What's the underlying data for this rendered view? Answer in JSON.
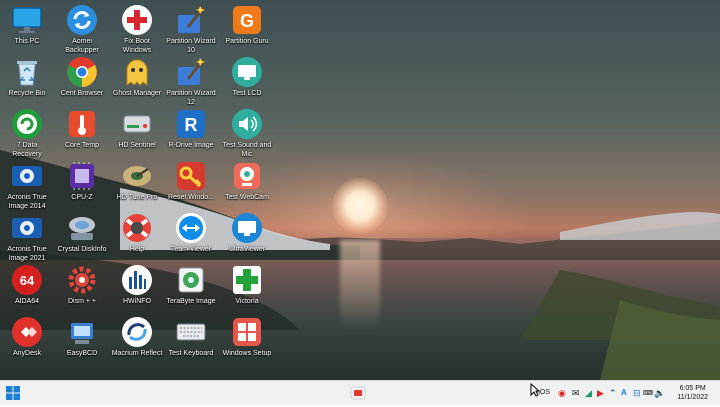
{
  "desktop_icons": [
    {
      "label": "This PC",
      "icon": "monitor-icon"
    },
    {
      "label": "Aomei Backupper",
      "icon": "refresh-arrows-icon"
    },
    {
      "label": "Fix Boot Windows",
      "icon": "red-cross-icon"
    },
    {
      "label": "Partition Wizard 10",
      "icon": "magic-wand-icon"
    },
    {
      "label": "Partition Guru",
      "icon": "partition-guru-icon"
    },
    {
      "label": "Recycle Bin",
      "icon": "recycle-bin-icon"
    },
    {
      "label": "Cent Browser",
      "icon": "browser-icon"
    },
    {
      "label": "Ghost Manager",
      "icon": "ghost-icon"
    },
    {
      "label": "Partition Wizard 12",
      "icon": "magic-wand-icon"
    },
    {
      "label": "Test LCD",
      "icon": "lcd-monitor-icon"
    },
    {
      "label": "7 Data Recovery",
      "icon": "data-recovery-icon"
    },
    {
      "label": "Core Temp",
      "icon": "thermometer-icon"
    },
    {
      "label": "HD Sentinel",
      "icon": "hard-drive-icon"
    },
    {
      "label": "R-Drive Image",
      "icon": "r-drive-icon"
    },
    {
      "label": "Test Sound and Mic",
      "icon": "speaker-icon"
    },
    {
      "label": "Acronis True Image 2014",
      "icon": "acronis-icon"
    },
    {
      "label": "CPU-Z",
      "icon": "cpu-icon"
    },
    {
      "label": "HD Tune Pro",
      "icon": "hd-tune-icon"
    },
    {
      "label": "Reset Windo...",
      "icon": "key-icon"
    },
    {
      "label": "Test WebCam",
      "icon": "webcam-icon"
    },
    {
      "label": "Acronis True Image 2021",
      "icon": "acronis-icon"
    },
    {
      "label": "Crystal DiskInfo",
      "icon": "disk-info-icon"
    },
    {
      "label": "Help",
      "icon": "lifebuoy-icon"
    },
    {
      "label": "Team Viewer",
      "icon": "teamviewer-icon"
    },
    {
      "label": "UltraViewer",
      "icon": "monitor-icon"
    },
    {
      "label": "AIDA64",
      "icon": "aida64-icon"
    },
    {
      "label": "Dism + +",
      "icon": "gear-icon"
    },
    {
      "label": "HWiNFO",
      "icon": "bar-chart-icon"
    },
    {
      "label": "TeraByte Image",
      "icon": "terabyte-icon"
    },
    {
      "label": "Victoria",
      "icon": "green-cross-icon"
    },
    {
      "label": "AnyDesk",
      "icon": "anydesk-icon"
    },
    {
      "label": "EasyBCD",
      "icon": "easybcd-icon"
    },
    {
      "label": "Macrium Reflect",
      "icon": "macrium-icon"
    },
    {
      "label": "Test Keyboard",
      "icon": "keyboard-icon"
    },
    {
      "label": "Windows Setup",
      "icon": "windows-setup-icon"
    }
  ],
  "aida_badge": "64",
  "taskbar": {
    "tray_text": "nOS",
    "language": "A",
    "time": "6:05 PM",
    "date": "11/1/2022"
  },
  "colors": {
    "taskbar_bg": "#eef0f2",
    "windows_blue": "#1a7fd4"
  }
}
